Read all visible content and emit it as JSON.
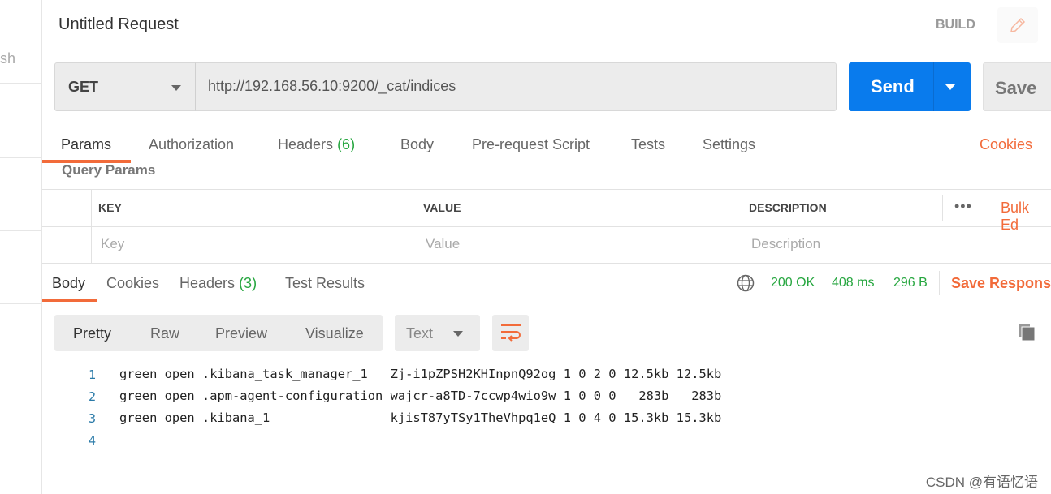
{
  "sidebar": {
    "partial_text": "sh"
  },
  "header": {
    "title": "Untitled Request",
    "mode": "BUILD"
  },
  "request": {
    "method": "GET",
    "url": "http://192.168.56.10:9200/_cat/indices",
    "send_label": "Send",
    "save_label": "Save"
  },
  "request_tabs": [
    {
      "label": "Params"
    },
    {
      "label": "Authorization"
    },
    {
      "label": "Headers",
      "count": "(6)"
    },
    {
      "label": "Body"
    },
    {
      "label": "Pre-request Script"
    },
    {
      "label": "Tests"
    },
    {
      "label": "Settings"
    }
  ],
  "cookies_link": "Cookies",
  "query_params": {
    "title": "Query Params",
    "columns": [
      "KEY",
      "VALUE",
      "DESCRIPTION"
    ],
    "placeholders": [
      "Key",
      "Value",
      "Description"
    ],
    "bulk_edit": "Bulk Ed"
  },
  "response_tabs": [
    {
      "label": "Body"
    },
    {
      "label": "Cookies"
    },
    {
      "label": "Headers",
      "count": "(3)"
    },
    {
      "label": "Test Results"
    }
  ],
  "status": {
    "code": "200 OK",
    "time": "408 ms",
    "size": "296 B",
    "save_response": "Save Response"
  },
  "format": {
    "options": [
      "Pretty",
      "Raw",
      "Preview",
      "Visualize"
    ],
    "selected": "Pretty",
    "type": "Text"
  },
  "response_lines": [
    "green open .kibana_task_manager_1   Zj-i1pZPSH2KHInpnQ92og 1 0 2 0 12.5kb 12.5kb",
    "green open .apm-agent-configuration wajcr-a8TD-7ccwp4wio9w 1 0 0 0   283b   283b",
    "green open .kibana_1                kjisT87yTSy1TheVhpq1eQ 1 0 4 0 15.3kb 15.3kb",
    ""
  ],
  "line_numbers": [
    "1",
    "2",
    "3",
    "4"
  ],
  "watermark": "CSDN @有语忆语",
  "colors": {
    "accent": "#f26b3a",
    "send": "#097bed",
    "status_green": "#26a63f"
  }
}
